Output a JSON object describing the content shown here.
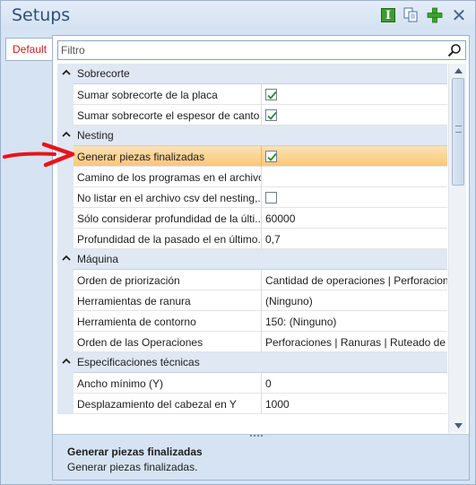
{
  "window": {
    "title": "Setups"
  },
  "toolbar": {
    "icons": [
      "info-icon",
      "copy-icon",
      "add-icon",
      "close-icon"
    ],
    "close_glyph": "✕"
  },
  "tabs": [
    {
      "label": "Default",
      "color": "#c8201a"
    }
  ],
  "search": {
    "placeholder": "Filtro",
    "value": ""
  },
  "categories": [
    {
      "label": "Sobrecorte",
      "rows": [
        {
          "name": "Sumar sobrecorte de la placa",
          "value": "",
          "checkbox": true,
          "checked": true
        },
        {
          "name": "Sumar sobrecorte el espesor de canto",
          "value": "",
          "checkbox": true,
          "checked": true
        }
      ]
    },
    {
      "label": "Nesting",
      "rows": [
        {
          "name": "Generar piezas finalizadas",
          "value": "",
          "checkbox": true,
          "checked": true,
          "selected": true
        },
        {
          "name": "Camino de los programas en el archivo...",
          "value": ""
        },
        {
          "name": "No listar en el archivo csv del nesting,...",
          "value": "",
          "checkbox": true,
          "checked": false
        },
        {
          "name": "Sólo considerar profundidad de la últi...",
          "value": "60000"
        },
        {
          "name": "Profundidad de la pasado el en último...",
          "value": "0,7"
        }
      ]
    },
    {
      "label": "Máquina",
      "rows": [
        {
          "name": "Orden de priorización",
          "value": "Cantidad de operaciones | Perforaciones"
        },
        {
          "name": "Herramientas de ranura",
          "value": "(Ninguno)"
        },
        {
          "name": "Herramienta de contorno",
          "value": "150: (Ninguno)"
        },
        {
          "name": "Orden de las Operaciones",
          "value": "Perforaciones | Ranuras | Ruteado de Co"
        }
      ]
    },
    {
      "label": "Especificaciones técnicas",
      "rows": [
        {
          "name": "Ancho mínimo (Y)",
          "value": "0"
        },
        {
          "name": "Desplazamiento del cabezal en Y",
          "value": "1000"
        }
      ]
    }
  ],
  "description": {
    "title": "Generar piezas finalizadas",
    "text": "Generar piezas finalizadas."
  },
  "annotation": {
    "type": "red-arrow",
    "points_to": "Generar piezas finalizadas",
    "color": "#e8141a"
  },
  "colors": {
    "selected_row": "#f9c77a",
    "category_bg": "#dfe8f3",
    "title_text": "#2d4f7c",
    "check_green": "#2e8a2e"
  }
}
